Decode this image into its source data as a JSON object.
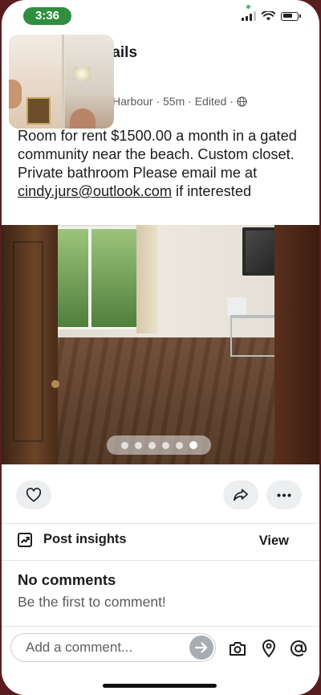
{
  "status_bar": {
    "time": "3:36"
  },
  "header": {
    "title_fragment": "tails"
  },
  "post": {
    "meta": "Harbour · 55m · Edited ·",
    "text_before_email": "Room for rent $1500.00 a month in a gated community near the beach. Custom closet.  Private bathroom Please email me at ",
    "email": "cindy.jurs@outlook.com",
    "text_after_email": " if interested"
  },
  "carousel": {
    "total": 6,
    "active_index": 5
  },
  "actions": {
    "like_icon": "heart-icon",
    "share_icon": "share-icon",
    "more_icon": "more-icon"
  },
  "insights": {
    "label": "Post insights",
    "view_label": "View"
  },
  "comments": {
    "title": "No comments",
    "subtitle": "Be the first to comment!"
  },
  "comment_bar": {
    "placeholder": "Add a comment...",
    "icons": [
      "camera-icon",
      "location-pin-icon",
      "at-sign-icon"
    ]
  },
  "colors": {
    "time_pill": "#2f8f3e",
    "button_bg": "#eceef0",
    "send_button": "#a8adb2",
    "outer_background": "#5a1d1f"
  }
}
